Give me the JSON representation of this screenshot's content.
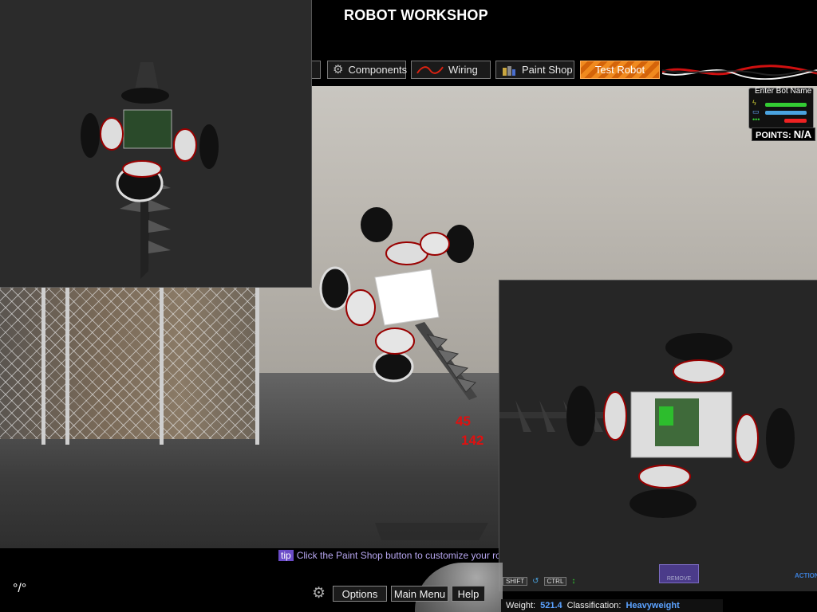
{
  "header": {
    "title": "ROBOT WORKSHOP"
  },
  "tabs": [
    {
      "label": "Components",
      "icon": "gear-icon"
    },
    {
      "label": "Wiring",
      "icon": "wire-icon"
    },
    {
      "label": "Paint Shop",
      "icon": "paint-cans-icon"
    },
    {
      "label": "Test Robot",
      "icon": "",
      "active": true
    }
  ],
  "bot_panel": {
    "name_label": "Enter Bot Name",
    "points_label": "POINTS:",
    "points_value": "N/A"
  },
  "readouts": {
    "value_a": "45",
    "value_b": "142"
  },
  "tip": {
    "badge": "tip",
    "text": "Click the Paint Shop button to customize your robot's ap"
  },
  "bottom": {
    "options": "Options",
    "main_menu": "Main Menu",
    "help": "Help",
    "keys": {
      "shift": "SHIFT",
      "ctrl": "CTRL"
    },
    "remove": "REMOVE",
    "action": "ACTION",
    "weight_label": "Weight:",
    "weight_value": "521.4",
    "class_label": "Classification:",
    "class_value": "Heavyweight"
  },
  "colors": {
    "accent": "#f08a1e",
    "tip": "#b7a6f0",
    "value_blue": "#5ba2ff",
    "readout_red": "#e01010"
  }
}
